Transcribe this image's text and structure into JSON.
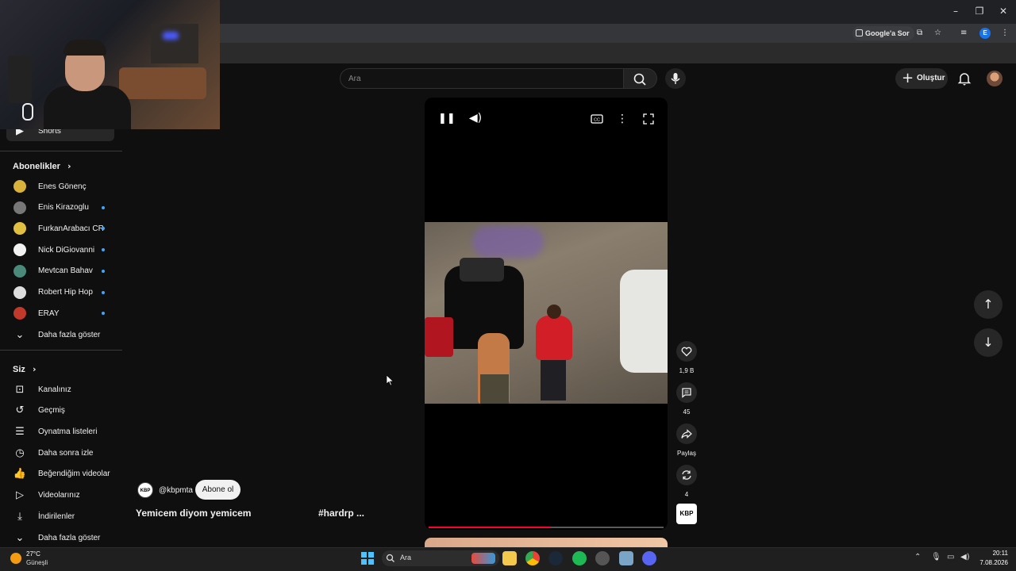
{
  "browser": {
    "google_sor_label": "Google'a Sor",
    "window_controls": [
      "minimize",
      "restore",
      "close"
    ],
    "profile_initial": "E"
  },
  "header": {
    "search_placeholder": "Ara",
    "create_label": "Oluştur"
  },
  "sidebar": {
    "shorts_label": "Shorts",
    "subscriptions_title": "Abonelikler",
    "subscriptions": [
      {
        "name": "Enes Gönenç",
        "new": false,
        "color": "#d8b23a"
      },
      {
        "name": "Enis Kirazoglu",
        "new": true,
        "color": "#777777"
      },
      {
        "name": "FurkanArabacı CR",
        "new": true,
        "color": "#e0c040"
      },
      {
        "name": "Nick DiGiovanni",
        "new": true,
        "color": "#f2f2f2"
      },
      {
        "name": "Mevtcan Bahav",
        "new": true,
        "color": "#4a8a7a"
      },
      {
        "name": "Robert Hip Hop",
        "new": true,
        "color": "#dddddd"
      },
      {
        "name": "ERAY",
        "new": true,
        "color": "#c0392b"
      }
    ],
    "show_more_label": "Daha fazla göster",
    "you_title": "Siz",
    "you_items": [
      {
        "label": "Kanalınız",
        "icon": "person-box-icon"
      },
      {
        "label": "Geçmiş",
        "icon": "history-icon"
      },
      {
        "label": "Oynatma listeleri",
        "icon": "playlist-icon"
      },
      {
        "label": "Daha sonra izle",
        "icon": "clock-icon"
      },
      {
        "label": "Beğendiğim videolar",
        "icon": "thumbs-up-icon"
      },
      {
        "label": "Videolarınız",
        "icon": "video-icon"
      },
      {
        "label": "İndirilenler",
        "icon": "download-icon"
      }
    ],
    "you_show_more_label": "Daha fazla göster"
  },
  "short": {
    "channel_handle": "@kbpmta",
    "channel_logo_text": "KBP",
    "subscribe_label": "Abone ol",
    "title": "Yemicem diyom yemicem",
    "tag": "#hardrp ...",
    "progress_fraction": 0.52,
    "actions": {
      "likes": "1,9 B",
      "comments": "45",
      "share": "Paylaş",
      "remix": "4"
    }
  },
  "taskbar": {
    "temperature": "27°C",
    "weather": "Güneşli",
    "search_label": "Ara",
    "time": "20:11",
    "date": "7.08.2026"
  },
  "colors": {
    "background": "#0f0f0f",
    "accent_red": "#ff0033",
    "new_dot": "#3ea6ff"
  }
}
